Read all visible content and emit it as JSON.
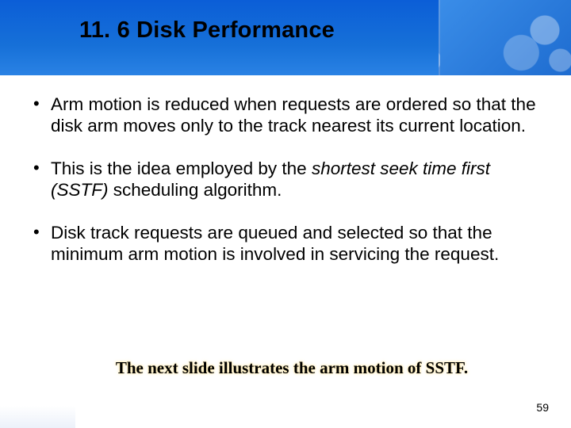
{
  "title": "11. 6 Disk Performance",
  "bullets": [
    {
      "text": "Arm motion is reduced when requests are ordered so that the disk arm moves only to the track nearest its current location."
    },
    {
      "prefix": "This is the idea employed by the ",
      "em": "shortest seek time first (SSTF)",
      "suffix": " scheduling algorithm."
    },
    {
      "text": "Disk track requests are queued and selected so that the minimum arm motion is involved in servicing the request."
    }
  ],
  "callout": "The next slide illustrates the arm motion of SSTF.",
  "page_number": "59"
}
